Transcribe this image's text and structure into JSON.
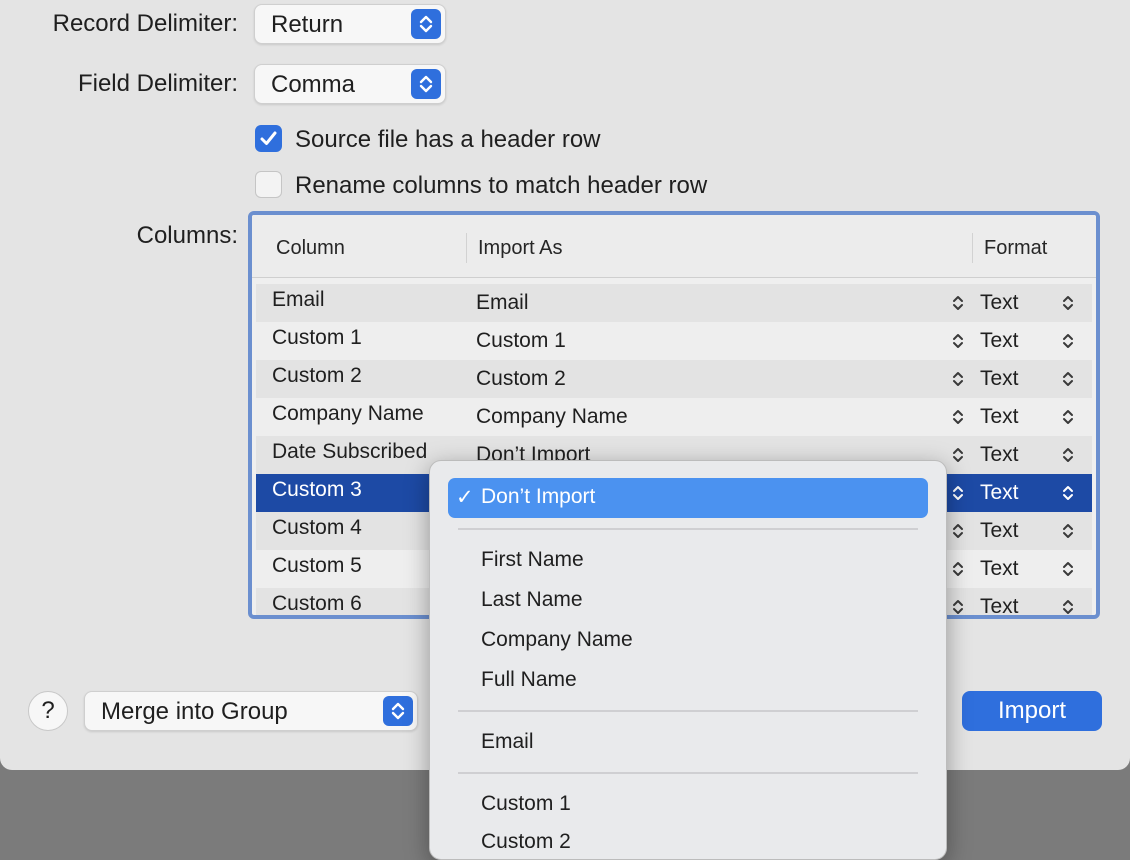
{
  "options": {
    "record_delimiter_label": "Record Delimiter:",
    "record_delimiter_value": "Return",
    "field_delimiter_label": "Field Delimiter:",
    "field_delimiter_value": "Comma",
    "header_row_label": "Source file has a header row",
    "header_row_checked": true,
    "rename_columns_label": "Rename columns to match header row",
    "rename_columns_checked": false,
    "columns_label": "Columns:"
  },
  "table": {
    "headers": [
      "Column",
      "Import As",
      "Format"
    ],
    "rows": [
      {
        "column": "Email",
        "import_as": "Email",
        "format": "Text"
      },
      {
        "column": "Custom 1",
        "import_as": "Custom 1",
        "format": "Text"
      },
      {
        "column": "Custom 2",
        "import_as": "Custom 2",
        "format": "Text"
      },
      {
        "column": "Company Name",
        "import_as": "Company Name",
        "format": "Text"
      },
      {
        "column": "Date Subscribed",
        "import_as": "Don’t Import",
        "format": "Text"
      },
      {
        "column": "Custom 3",
        "import_as": "",
        "format": "Text",
        "selected": true
      },
      {
        "column": "Custom 4",
        "import_as": "",
        "format": "Text"
      },
      {
        "column": "Custom 5",
        "import_as": "",
        "format": "Text"
      },
      {
        "column": "Custom 6",
        "import_as": "",
        "format": "Text"
      }
    ]
  },
  "footer": {
    "help_label": "?",
    "merge_label": "Merge into Group",
    "import_label": "Import"
  },
  "menu": {
    "selected": "Don’t Import",
    "check_mark": "✓",
    "group1": [
      "First Name",
      "Last Name",
      "Company Name",
      "Full Name"
    ],
    "group2": [
      "Email"
    ],
    "group3": [
      "Custom 1",
      "Custom 2"
    ]
  },
  "colors": {
    "accent": "#2f6fdd",
    "selection": "#1d4aa5",
    "menu_highlight": "#4b92f0"
  }
}
